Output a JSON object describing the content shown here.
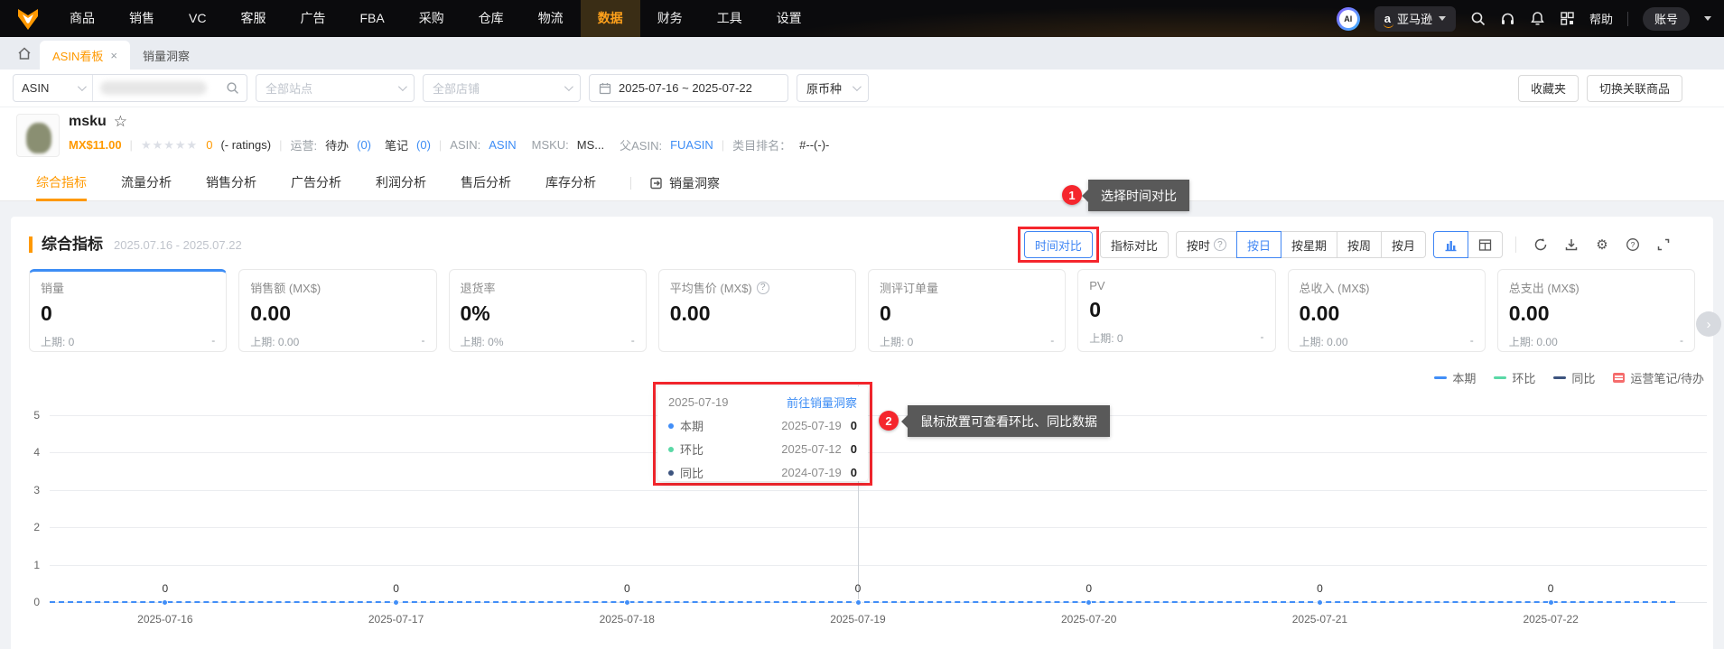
{
  "nav": {
    "items": [
      "商品",
      "销售",
      "VC",
      "客服",
      "广告",
      "FBA",
      "采购",
      "仓库",
      "物流",
      "数据",
      "财务",
      "工具",
      "设置"
    ],
    "active_item": "数据",
    "ai_badge": "AI",
    "marketplace": "亚马逊",
    "help": "帮助",
    "account": "账号"
  },
  "tabs_bar": {
    "tabs": [
      {
        "label": "ASIN看板",
        "close": "×",
        "active": true
      },
      {
        "label": "销量洞察",
        "active": false
      }
    ]
  },
  "filters": {
    "search_type": "ASIN",
    "site_placeholder": "全部站点",
    "shop_placeholder": "全部店铺",
    "date_range": "2025-07-16 ~ 2025-07-22",
    "currency": "原币种",
    "favorites_btn": "收藏夹",
    "switch_btn": "切换关联商品"
  },
  "product": {
    "name": "msku",
    "price": "MX$11.00",
    "stars": "★★★★★",
    "rating_value": "0",
    "rating_note": "(- ratings)",
    "ops_label": "运营:",
    "todo_label": "待办",
    "todo_count": "(0)",
    "note_label": "笔记",
    "note_count": "(0)",
    "asin_label": "ASIN:",
    "asin_value": "ASIN",
    "msku_label": "MSKU:",
    "msku_value": "MS...",
    "parent_label": "父ASIN:",
    "parent_value": "FUASIN",
    "rank_label": "类目排名：",
    "rank_value": "#--(-)-"
  },
  "analysis_tabs": {
    "items": [
      "综合指标",
      "流量分析",
      "销售分析",
      "广告分析",
      "利润分析",
      "售后分析",
      "库存分析"
    ],
    "active_item": "综合指标",
    "insight_link": "销量洞察"
  },
  "section": {
    "title": "综合指标",
    "date_range": "2025.07.16 - 2025.07.22",
    "compare_time_btn": "时间对比",
    "compare_metric_btn": "指标对比",
    "granularity": [
      "按时",
      "按日",
      "按星期",
      "按周",
      "按月"
    ],
    "granularity_active": "按日",
    "granularity_help_on": "按时"
  },
  "annotations": {
    "step1": {
      "num": "1",
      "text": "选择时间对比"
    },
    "step2": {
      "num": "2",
      "text": "鼠标放置可查看环比、同比数据"
    }
  },
  "metric_cards": [
    {
      "label": "销量",
      "value": "0",
      "prev": "上期: 0",
      "dash": "-",
      "active": true
    },
    {
      "label": "销售额 (MX$)",
      "value": "0.00",
      "prev": "上期: 0.00",
      "dash": "-"
    },
    {
      "label": "退货率",
      "value": "0%",
      "prev": "上期: 0%",
      "dash": "-"
    },
    {
      "label": "平均售价 (MX$)",
      "value": "0.00",
      "prev": "",
      "dash": "",
      "help": true
    },
    {
      "label": "测评订单量",
      "value": "0",
      "prev": "上期: 0",
      "dash": "-"
    },
    {
      "label": "PV",
      "value": "0",
      "prev": "上期: 0",
      "dash": "-"
    },
    {
      "label": "总收入 (MX$)",
      "value": "0.00",
      "prev": "上期: 0.00",
      "dash": "-"
    },
    {
      "label": "总支出 (MX$)",
      "value": "0.00",
      "prev": "上期: 0.00",
      "dash": "-"
    }
  ],
  "legend": [
    {
      "label": "本期",
      "color": "#418ef7",
      "type": "line"
    },
    {
      "label": "环比",
      "color": "#5ad8a6",
      "type": "line"
    },
    {
      "label": "同比",
      "color": "#3d547f",
      "type": "line"
    },
    {
      "label": "运营笔记/待办",
      "color": "#f56c6c",
      "type": "note"
    }
  ],
  "tooltip": {
    "date": "2025-07-19",
    "link": "前往销量洞察",
    "rows": [
      {
        "name": "本期",
        "date": "2025-07-19",
        "value": "0",
        "color": "#418ef7"
      },
      {
        "name": "环比",
        "date": "2025-07-12",
        "value": "0",
        "color": "#5ad8a6"
      },
      {
        "name": "同比",
        "date": "2024-07-19",
        "value": "0",
        "color": "#3d547f"
      }
    ]
  },
  "chart_data": {
    "type": "line",
    "x": [
      "2025-07-16",
      "2025-07-17",
      "2025-07-18",
      "2025-07-19",
      "2025-07-20",
      "2025-07-21",
      "2025-07-22"
    ],
    "series": [
      {
        "name": "本期",
        "values": [
          0,
          0,
          0,
          0,
          0,
          0,
          0
        ]
      }
    ],
    "point_labels": [
      "0",
      "0",
      "0",
      "0",
      "0",
      "0",
      "0"
    ],
    "yticks": [
      0,
      1,
      2,
      3,
      4,
      5
    ],
    "ylim": [
      0,
      5
    ],
    "grid": true,
    "legend_position": "top-right",
    "hover_x": "2025-07-19",
    "line_color": "#418ef7",
    "line_style": "dashed"
  }
}
